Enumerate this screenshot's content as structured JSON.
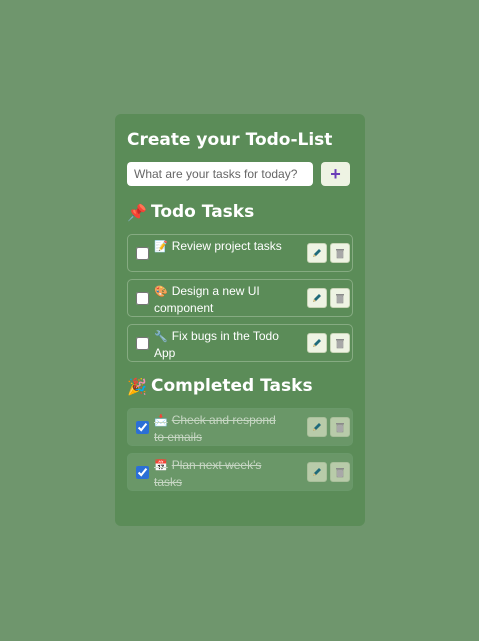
{
  "app": {
    "title": "Create your Todo-List"
  },
  "input": {
    "placeholder": "What are your tasks for today?",
    "value": "",
    "add_label": "+"
  },
  "todo": {
    "title": "Todo Tasks",
    "emoji": "📌",
    "items": [
      {
        "emoji": "📝",
        "text": "Review project tasks",
        "checked": false
      },
      {
        "emoji": "🎨",
        "text": "Design a new UI component",
        "checked": false
      },
      {
        "emoji": "🔧",
        "text": "Fix bugs in the Todo App",
        "checked": false
      }
    ]
  },
  "completed": {
    "title": "Completed Tasks",
    "emoji": "🎉",
    "items": [
      {
        "emoji": "📩",
        "text": "Check and respond to emails",
        "checked": true
      },
      {
        "emoji": "📅",
        "text": "Plan next week's tasks",
        "checked": true
      }
    ]
  },
  "icons": {
    "edit": "pencil-icon",
    "delete": "trash-icon",
    "add": "plus-icon"
  },
  "colors": {
    "background": "#6f966d",
    "card": "#5b8c58",
    "accent": "#6a3db8",
    "pencil": "#1f6a7a"
  }
}
